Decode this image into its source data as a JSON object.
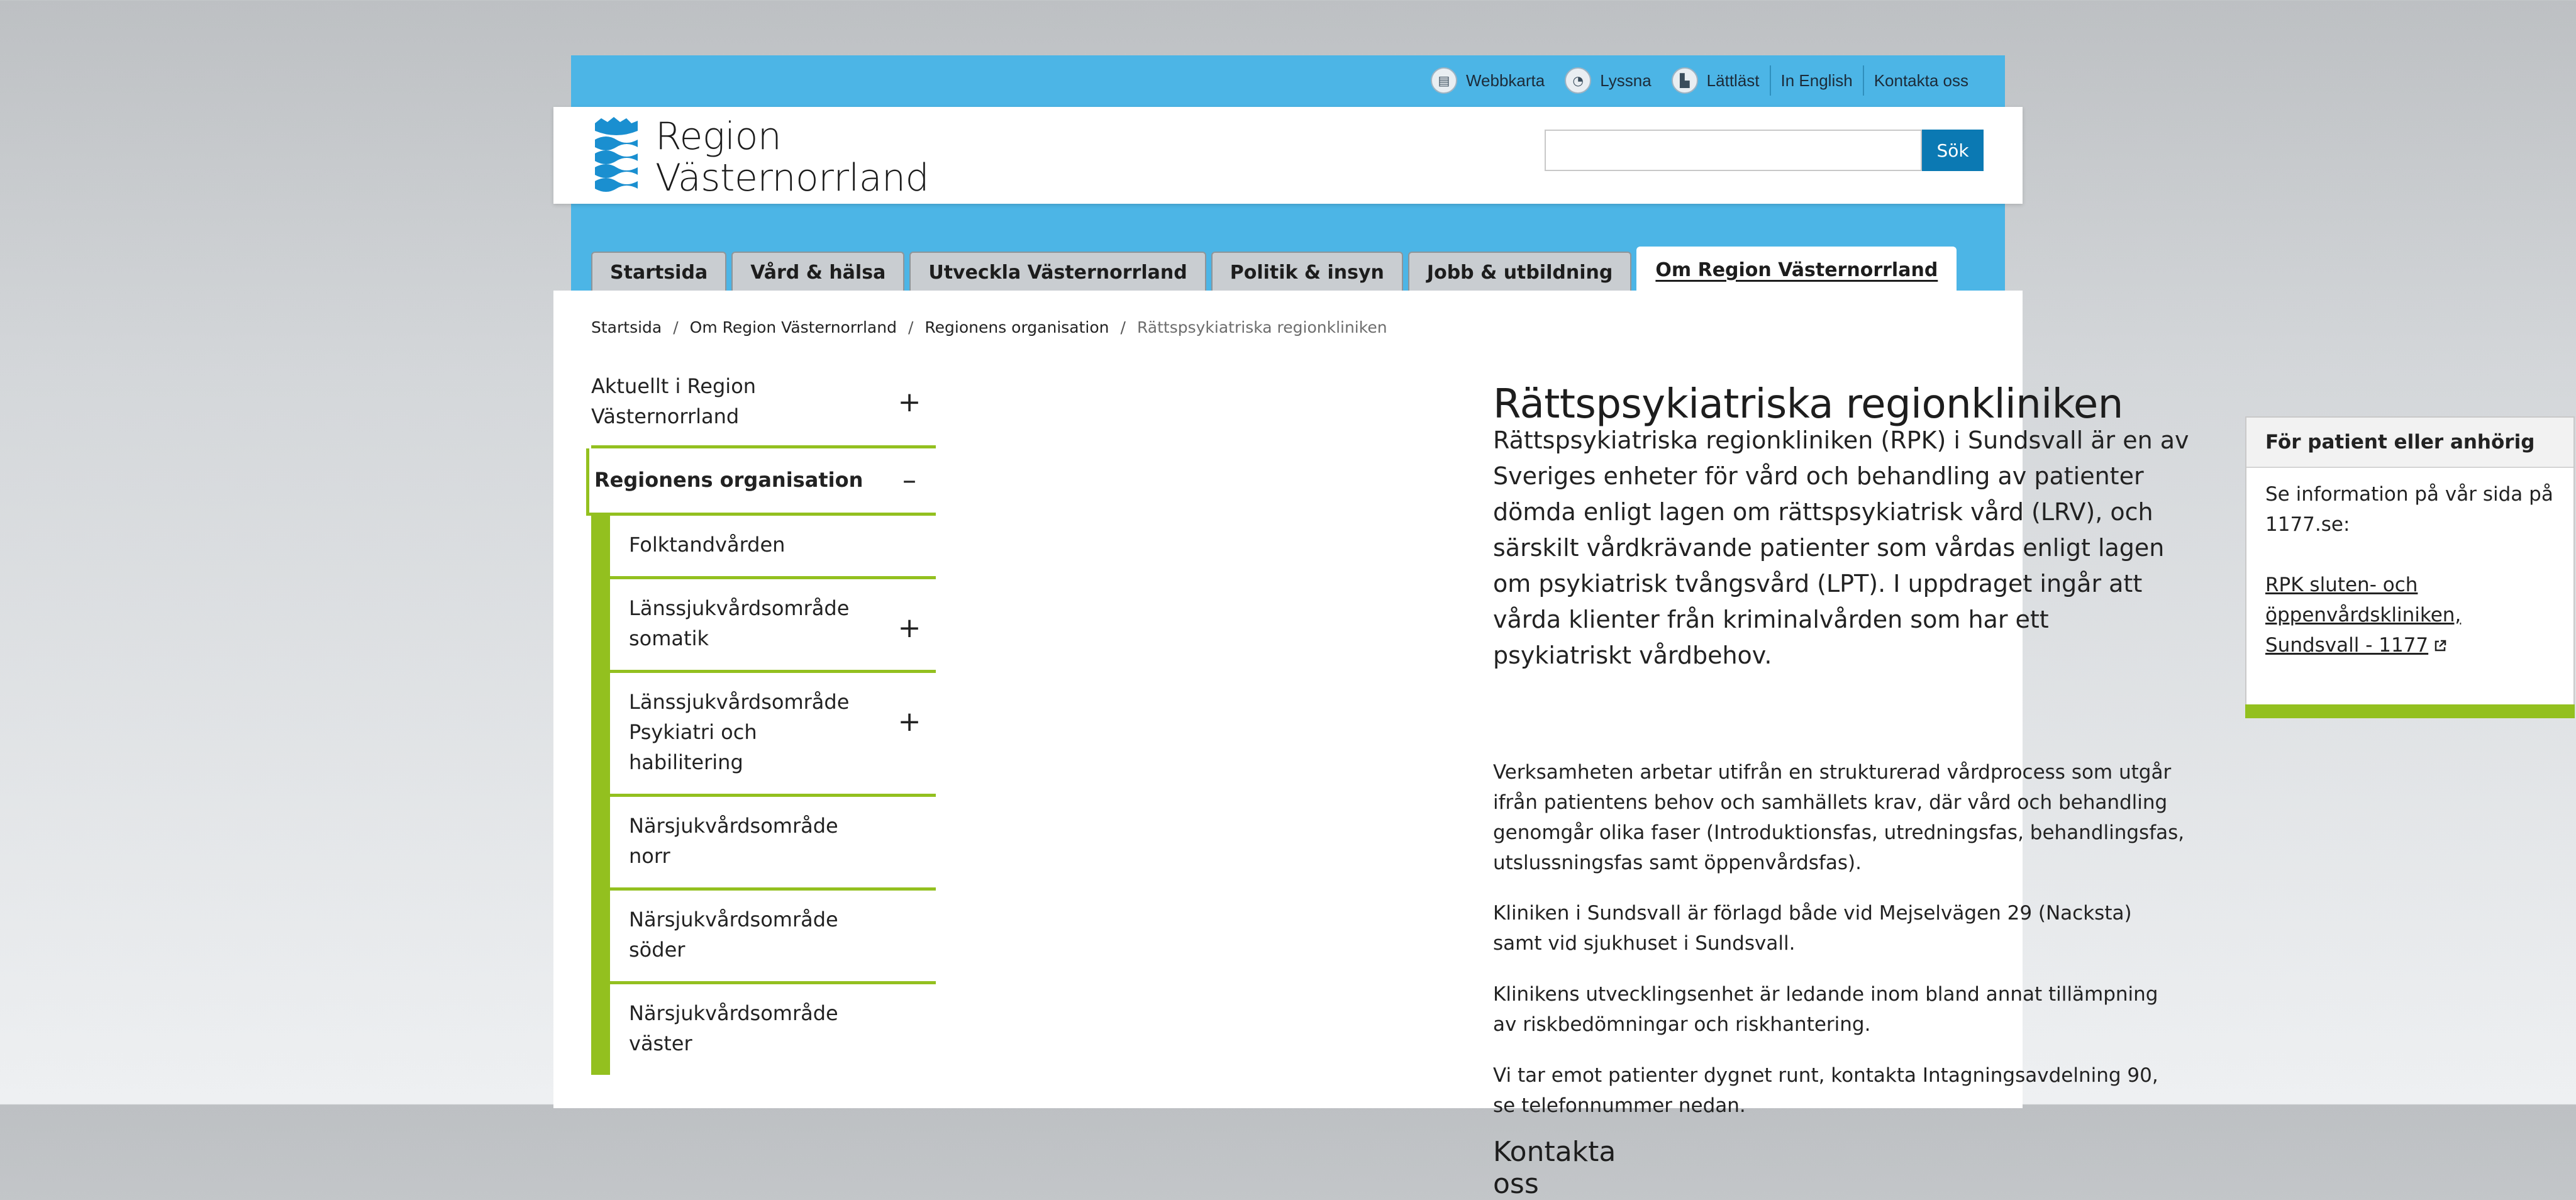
{
  "utility_nav": [
    {
      "label": "Webbkarta",
      "icon": "sitemap-icon",
      "glyph": "▤"
    },
    {
      "label": "Lyssna",
      "icon": "listen-icon",
      "glyph": "◔"
    },
    {
      "label": "Lättläst",
      "icon": "easy-read-icon",
      "glyph": "▙"
    },
    {
      "label": "In English"
    },
    {
      "label": "Kontakta oss"
    }
  ],
  "logo": {
    "line1": "Region",
    "line2": "Västernorrland"
  },
  "search": {
    "button_label": "Sök",
    "value": ""
  },
  "colors": {
    "brand_blue": "#4cb5e6",
    "accent_green": "#93c01f",
    "button_blue": "#0b79b3"
  },
  "main_nav": [
    {
      "label": "Startsida"
    },
    {
      "label": "Vård & hälsa"
    },
    {
      "label": "Utveckla Västernorrland"
    },
    {
      "label": "Politik & insyn"
    },
    {
      "label": "Jobb & utbildning"
    },
    {
      "label": "Om Region Västernorrland",
      "active": true
    }
  ],
  "breadcrumb": {
    "items": [
      "Startsida",
      "Om Region Västernorrland",
      "Regionens organisation"
    ],
    "current": "Rättspsykiatriska regionkliniken",
    "separator": "/"
  },
  "left_nav": {
    "top": {
      "label": "Aktuellt i Region Västernorrland",
      "toggle": "+"
    },
    "current": {
      "label": "Regionens organisation",
      "toggle": "–"
    },
    "children": [
      {
        "label": "Folktandvården",
        "toggle": ""
      },
      {
        "label": "Länssjukvårdsområde somatik",
        "toggle": "+"
      },
      {
        "label": "Länssjukvårdsområde Psykiatri och habilitering",
        "toggle": "+"
      },
      {
        "label": "Närsjukvårdsområde norr",
        "toggle": ""
      },
      {
        "label": "Närsjukvårdsområde söder",
        "toggle": ""
      },
      {
        "label": "Närsjukvårdsområde väster",
        "toggle": ""
      }
    ]
  },
  "article": {
    "title": "Rättspsykiatriska regionkliniken",
    "lead": "Rättspsykiatriska regionkliniken (RPK) i Sundsvall är en av Sveriges enheter för vård och behandling av patienter dömda enligt lagen om rättspsykiatrisk vård (LRV), och särskilt vårdkrävande patienter som vårdas enligt lagen om psykiatrisk tvångsvård (LPT). I uppdraget ingår att vårda klienter från kriminalvården som har ett psykiatriskt vårdbehov.",
    "paragraphs": [
      "Verksamheten arbetar utifrån en strukturerad vårdprocess som utgår ifrån patientens behov och samhällets krav, där vård och behandling genomgår olika faser (Introduktionsfas, utredningsfas, behandlingsfas, utslussningsfas samt öppenvårdsfas).",
      "Kliniken i Sundsvall är förlagd både vid Mejselvägen 29 (Nacksta) samt vid sjukhuset i Sundsvall.",
      "Klinikens utvecklingsenhet är ledande inom bland annat tillämpning av riskbedömningar och riskhantering.",
      "Vi tar emot patienter dygnet runt, kontakta Intagningsavdelning 90, se telefonnummer nedan."
    ],
    "subheading": "Kontakta oss"
  },
  "sidebox": {
    "heading": "För patient eller anhörig",
    "text": "Se information på vår sida på 1177.se:",
    "link": "RPK sluten- och öppenvårdskliniken, Sundsvall - 1177"
  }
}
